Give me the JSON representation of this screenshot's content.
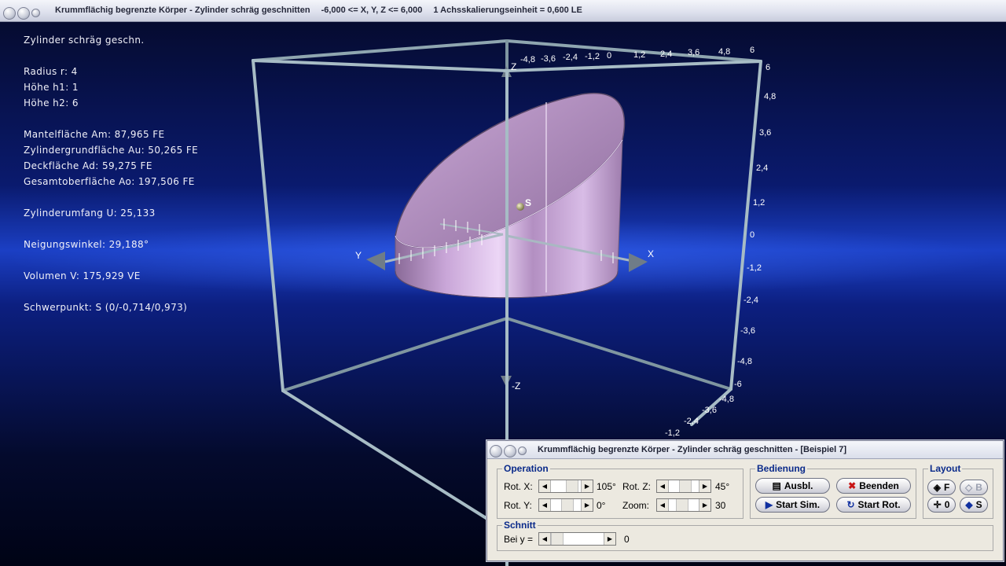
{
  "window": {
    "title": "Krummflächig begrenzte Körper - Zylinder schräg geschnitten",
    "range": "-6,000 <= X, Y, Z <= 6,000",
    "scale": "1 Achsskalierungseinheit = 0,600 LE"
  },
  "info": {
    "heading": "Zylinder schräg geschn.",
    "radius": "Radius r: 4",
    "h1": "Höhe h1: 1",
    "h2": "Höhe h2: 6",
    "mantel": "Mantelfläche Am: 87,965 FE",
    "grund": "Zylindergrundfläche Au: 50,265 FE",
    "deck": "Deckfläche Ad: 59,275 FE",
    "gesamt": "Gesamtoberfläche Ao: 197,506 FE",
    "umfang": "Zylinderumfang U: 25,133",
    "neigung": "Neigungswinkel: 29,188°",
    "volumen": "Volumen V: 175,929 VE",
    "schwerpunkt": "Schwerpunkt: S (0/-0,714/0,973)"
  },
  "axes": {
    "x_label": "X",
    "y_label": "Y",
    "z_label": "Z",
    "negz_label": "-Z",
    "centroid_label": "S",
    "top_ticks": [
      "-4,8",
      "-3,6",
      "-2,4",
      "-1,2",
      "0",
      "1,2",
      "2,4",
      "3,6",
      "4,8",
      "6"
    ],
    "right_ticks": [
      "6",
      "4,8",
      "3,6",
      "2,4",
      "1,2",
      "0",
      "-1,2",
      "-2,4",
      "-3,6",
      "-4,8",
      "-6"
    ],
    "bottom_ticks": [
      "-4,8",
      "-3,6",
      "-2,4",
      "-1,2"
    ],
    "colors": {
      "frame": "#9fb6bf",
      "cylinder": "#c8a8d8"
    }
  },
  "dialog": {
    "title": "Krummflächig begrenzte Körper - Zylinder schräg geschnitten - [Beispiel 7]",
    "operation": {
      "legend": "Operation",
      "rotx_label": "Rot. X:",
      "rotx_value": "105°",
      "roty_label": "Rot. Y:",
      "roty_value": "0°",
      "rotz_label": "Rot. Z:",
      "rotz_value": "45°",
      "zoom_label": "Zoom:",
      "zoom_value": "30"
    },
    "bedienung": {
      "legend": "Bedienung",
      "ausbl": "Ausbl.",
      "beenden": "Beenden",
      "start_sim": "Start Sim.",
      "start_rot": "Start Rot."
    },
    "layout": {
      "legend": "Layout",
      "f": "F",
      "b": "B",
      "o": "0",
      "s": "S"
    },
    "schnitt": {
      "legend": "Schnitt",
      "label": "Bei y =",
      "value": "0"
    }
  }
}
